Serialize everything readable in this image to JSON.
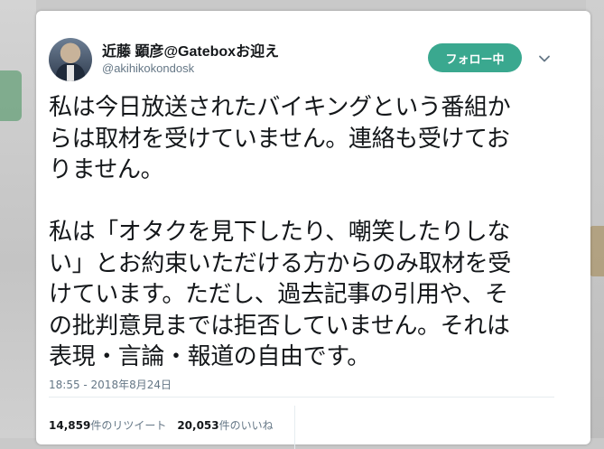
{
  "tweet": {
    "display_name": "近藤 顕彦@Gateboxお迎え",
    "screen_name": "@akihikokondosk",
    "follow_label": "フォロー中",
    "text_lines_p1": [
      "私は今日放送されたバイキングという番組か",
      "らは取材を受けていません。連絡も受けてお",
      "りません。"
    ],
    "text_lines_p2": [
      "私は「オタクを見下したり、嘲笑したりしな",
      "い」とお約束いただける方からのみ取材を受",
      "けています。ただし、過去記事の引用や、そ",
      "の批判意見までは拒否していません。それは",
      "表現・言論・報道の自由です。"
    ],
    "timestamp": "18:55 - 2018年8月24日",
    "retweet_count": "14,859",
    "retweet_label": "件のリツイート",
    "like_count": "20,053",
    "like_label": "件のいいね"
  },
  "icons": {
    "chevron": "chevron-down-icon"
  },
  "colors": {
    "follow_button": "#3aa88f",
    "text": "#14171a",
    "secondary_text": "#657786"
  }
}
